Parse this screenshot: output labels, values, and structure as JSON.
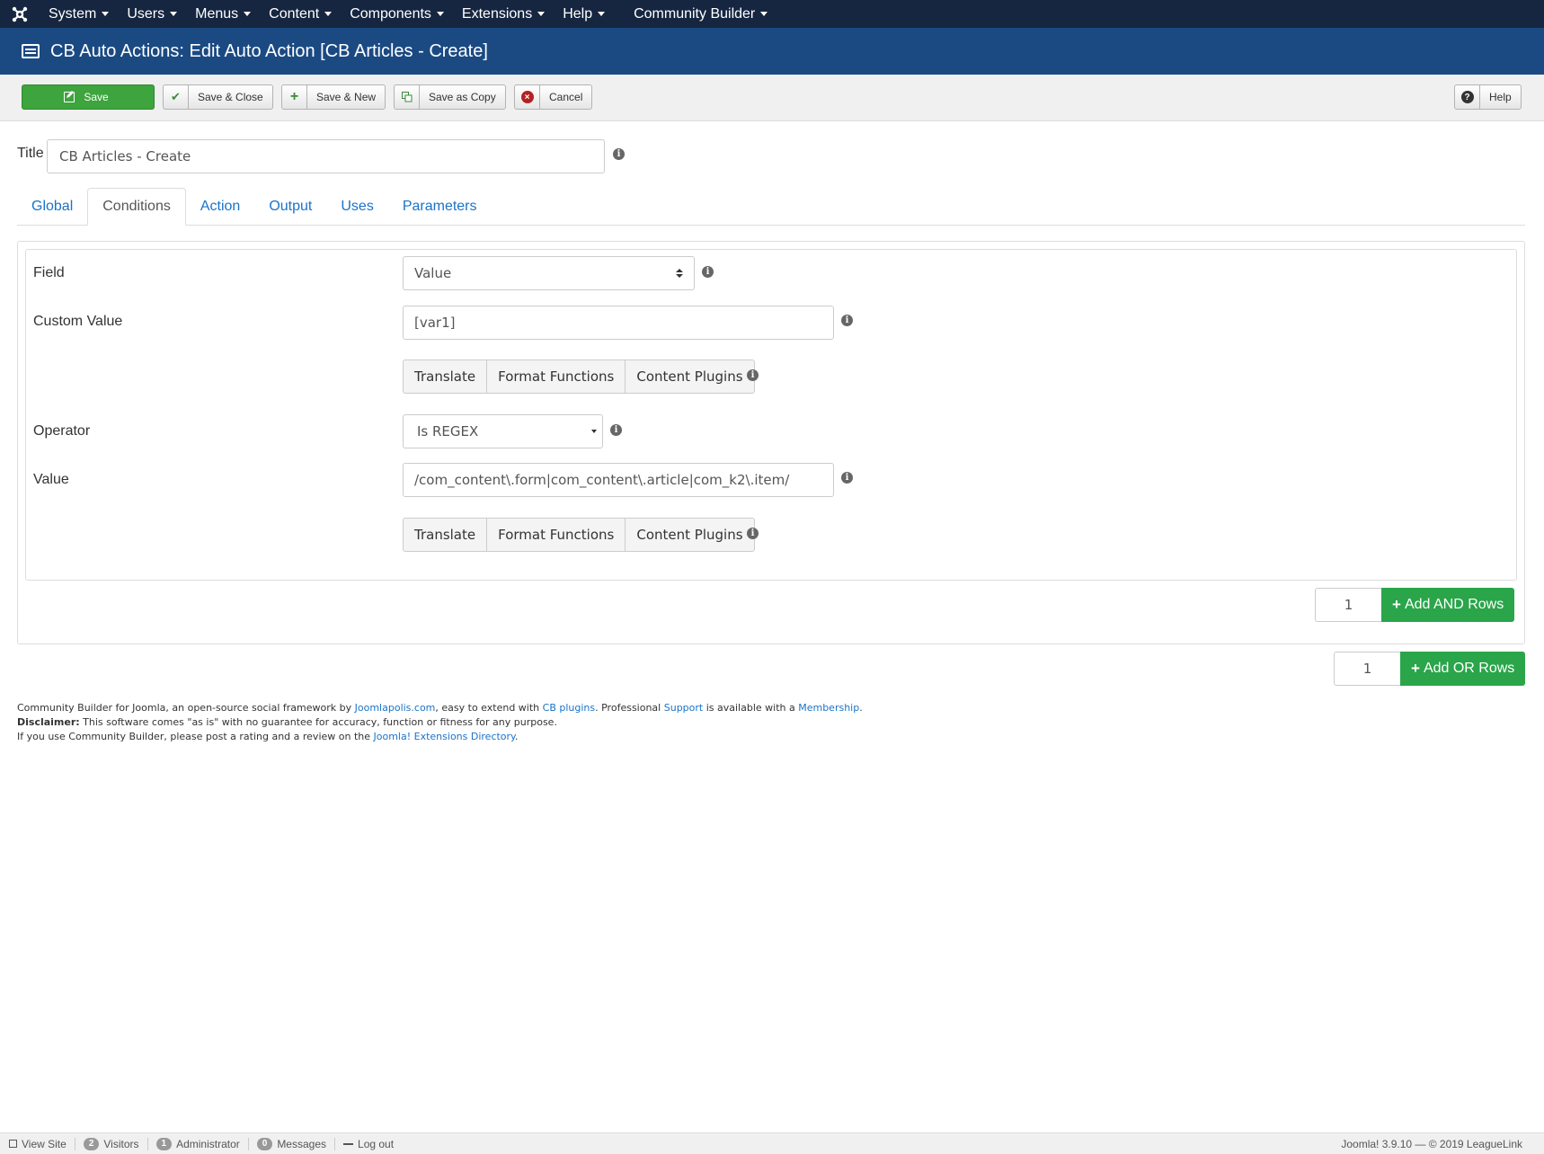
{
  "topnav": {
    "logo_icon": "joomla-logo-icon",
    "items": [
      {
        "label": "System"
      },
      {
        "label": "Users"
      },
      {
        "label": "Menus"
      },
      {
        "label": "Content"
      },
      {
        "label": "Components"
      },
      {
        "label": "Extensions"
      },
      {
        "label": "Help"
      }
    ],
    "community_builder": "Community Builder"
  },
  "header": {
    "title": "CB Auto Actions: Edit Auto Action [CB Articles - Create]"
  },
  "toolbar": {
    "save": "Save",
    "save_close": "Save & Close",
    "save_new": "Save & New",
    "save_copy": "Save as Copy",
    "cancel": "Cancel",
    "help": "Help"
  },
  "form": {
    "title_label": "Title",
    "title_value": "CB Articles - Create"
  },
  "tabs": [
    {
      "label": "Global"
    },
    {
      "label": "Conditions"
    },
    {
      "label": "Action"
    },
    {
      "label": "Output"
    },
    {
      "label": "Uses"
    },
    {
      "label": "Parameters"
    }
  ],
  "conditions": {
    "field_label": "Field",
    "field_value": "Value",
    "custom_value_label": "Custom Value",
    "custom_value": "[var1]",
    "operator_label": "Operator",
    "operator_value": "Is REGEX",
    "value_label": "Value",
    "value_value": "/com_content\\.form|com_content\\.article|com_k2\\.item/",
    "buttons": {
      "translate": "Translate",
      "format_functions": "Format Functions",
      "content_plugins": "Content Plugins"
    },
    "and_rows_count": "1",
    "add_and_rows": "Add AND Rows",
    "or_rows_count": "1",
    "add_or_rows": "Add OR Rows"
  },
  "footer": {
    "line1_a": "Community Builder for Joomla, an open-source social framework by ",
    "link_joomlapolis": "Joomlapolis.com",
    "line1_b": ", easy to extend with ",
    "link_cbplugins": "CB plugins",
    "line1_c": ". Professional ",
    "link_support": "Support",
    "line1_d": " is available with a ",
    "link_membership": "Membership",
    "line1_e": ".",
    "disclaimer_label": "Disclaimer:",
    "disclaimer_text": " This software comes \"as is\" with no guarantee for accuracy, function or fitness for any purpose.",
    "line3_a": "If you use Community Builder, please post a rating and a review on the ",
    "link_jed": "Joomla! Extensions Directory",
    "line3_b": "."
  },
  "statusbar": {
    "view_site": "View Site",
    "visitors_count": "2",
    "visitors": "Visitors",
    "admin_count": "1",
    "administrator": "Administrator",
    "messages_count": "0",
    "messages": "Messages",
    "logout": "Log out",
    "version": "Joomla! 3.9.10  —  © 2019 LeagueLink"
  }
}
